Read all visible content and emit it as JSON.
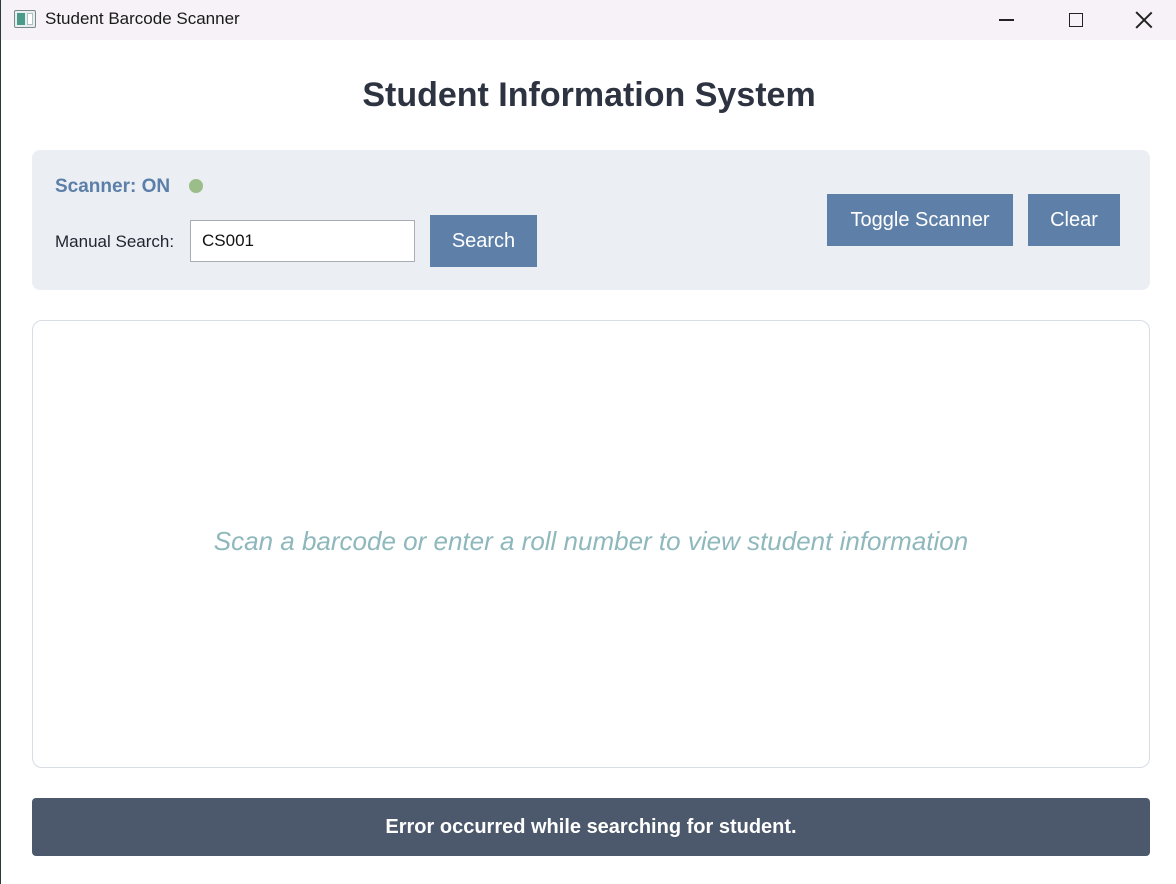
{
  "window": {
    "title": "Student Barcode Scanner"
  },
  "header": {
    "title": "Student Information System"
  },
  "controls": {
    "scanner_status": "Scanner: ON",
    "status_color": "#9bbd8a",
    "manual_search_label": "Manual Search:",
    "search_value": "CS001",
    "search_button": "Search",
    "toggle_button": "Toggle Scanner",
    "clear_button": "Clear"
  },
  "info_panel": {
    "placeholder": "Scan a barcode or enter a roll number to view student information"
  },
  "status_bar": {
    "message": "Error occurred while searching for student."
  },
  "colors": {
    "accent": "#5e80a8",
    "status_bar_bg": "#4c586b",
    "panel_bg": "#ebeef3",
    "placeholder_text": "#8fb8bc"
  }
}
